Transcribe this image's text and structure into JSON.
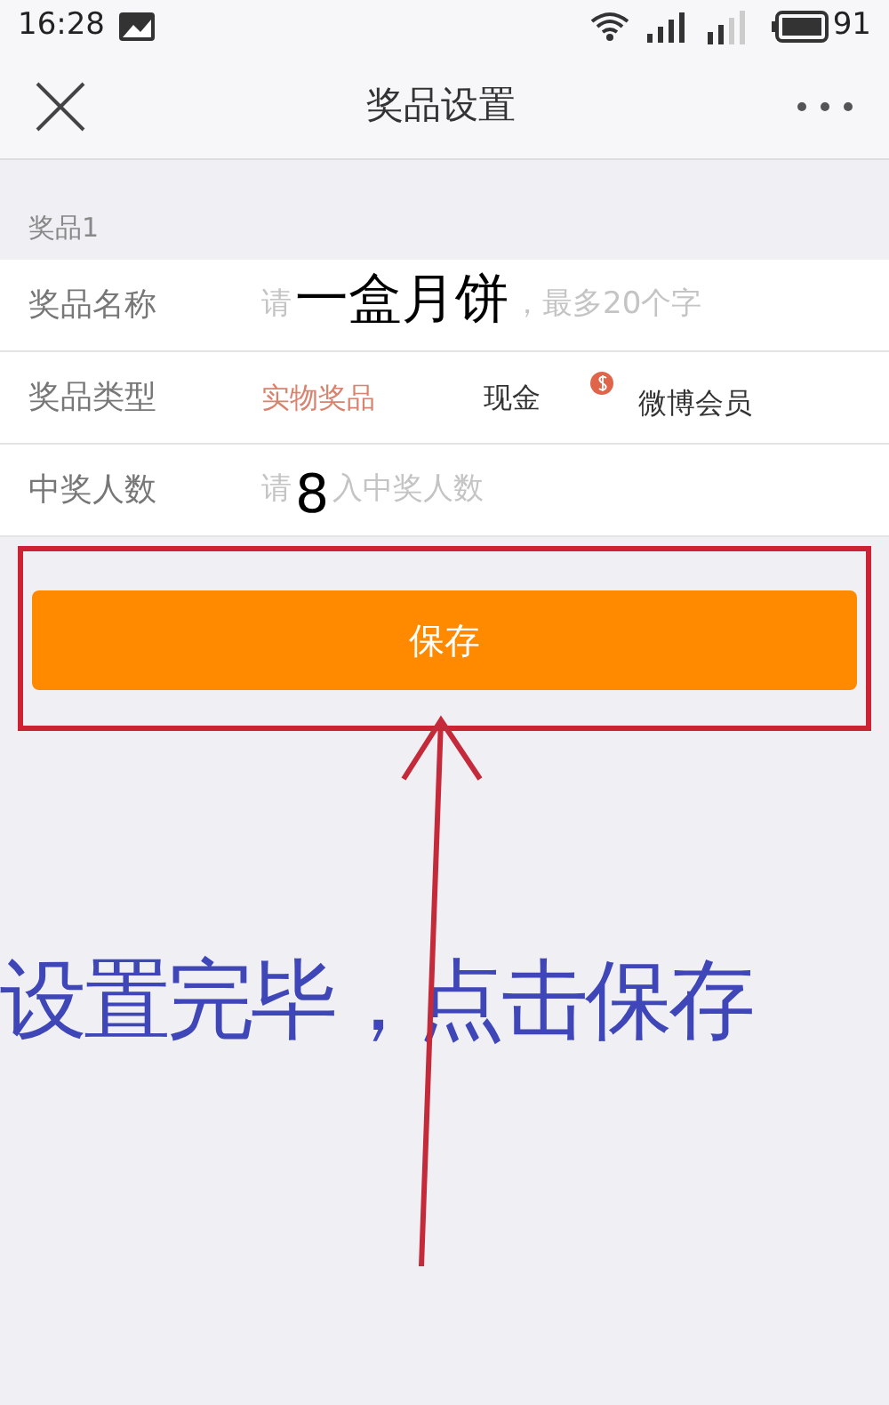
{
  "status_bar": {
    "time": "16:28",
    "battery": "91"
  },
  "header": {
    "title": "奖品设置"
  },
  "section": {
    "title": "奖品1"
  },
  "fields": [
    {
      "kind": "input",
      "label": "奖品名称",
      "hint_before": "请",
      "overlay": "一盒月饼",
      "hint_after": "，最多20个字"
    },
    {
      "kind": "options",
      "label": "奖品类型",
      "options": [
        {
          "label": "实物奖品",
          "selected": true,
          "badge": false
        },
        {
          "label": "现金",
          "selected": false,
          "badge": false
        },
        {
          "label": "微博会员",
          "selected": false,
          "badge": true
        }
      ]
    },
    {
      "kind": "input",
      "label": "中奖人数",
      "hint_before": "请",
      "overlay": "8",
      "hint_after": "入中奖人数"
    }
  ],
  "save_button": {
    "label": "保存"
  },
  "annotation": {
    "text": "设置完毕，点击保存"
  }
}
